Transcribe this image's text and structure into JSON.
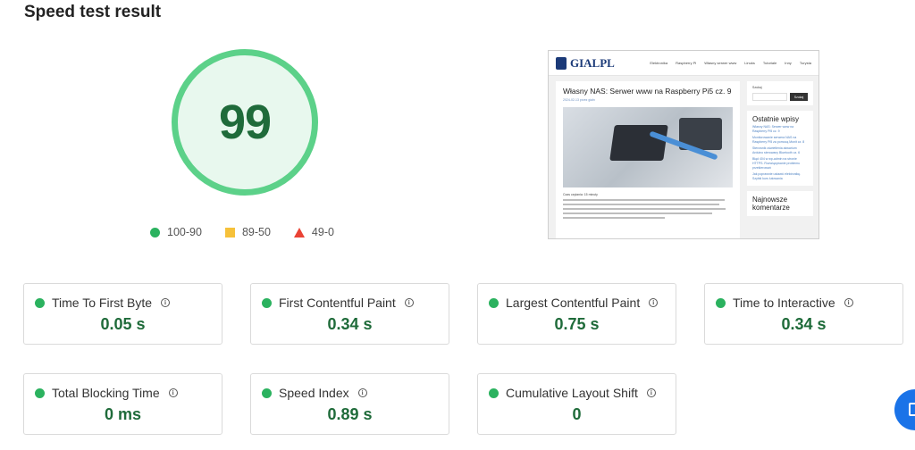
{
  "page": {
    "title": "Speed test result"
  },
  "score": {
    "value": "99",
    "color_good": "#5cd189",
    "legend": [
      {
        "label": "100-90",
        "shape": "circle",
        "color": "#2bb25f"
      },
      {
        "label": "89-50",
        "shape": "square",
        "color": "#f6c13a"
      },
      {
        "label": "49-0",
        "shape": "triangle",
        "color": "#ea4335"
      }
    ]
  },
  "preview": {
    "logo": "GIALPL",
    "menu": [
      "Elektronika",
      "Raspberry Pi",
      "Własny serwer www",
      "Linuks",
      "Tutoriale",
      "Inny",
      "Turysta"
    ],
    "post_title": "Własny NAS: Serwer www na Raspberry Pi5 cz. 9",
    "post_meta": "2024-02-13 przez gialn",
    "post_text": "Czas czytania: 15 minuty",
    "search_button": "Szukaj",
    "search_label": "Szukaj",
    "recent_title": "Ostatnie wpisy",
    "recent_links": [
      "Własny NAS: Serwer www na Raspberry Pi5 cz. 9",
      "Monitorowanie serwera NAS na Raspberry Pi5 za pomocą Monit cz. 8",
      "Sterownik oświetlenia akwarium Arduino sterowany Bluetooth cz. 6",
      "Błąd 404 w wp-admin na stronie HTTPS. Rozwiązywanie problemu przekierowań",
      "Jak poprawnie ustawić elektronikę. Szybki kurs lutowania"
    ],
    "comments_title": "Najnowsze komentarze"
  },
  "metrics": [
    {
      "label": "Time To First Byte",
      "value": "0.05 s"
    },
    {
      "label": "First Contentful Paint",
      "value": "0.34 s"
    },
    {
      "label": "Largest Contentful Paint",
      "value": "0.75 s"
    },
    {
      "label": "Time to Interactive",
      "value": "0.34 s"
    },
    {
      "label": "Total Blocking Time",
      "value": "0 ms"
    },
    {
      "label": "Speed Index",
      "value": "0.89 s"
    },
    {
      "label": "Cumulative Layout Shift",
      "value": "0"
    }
  ],
  "info_icon_glyph": "i",
  "status_color": "#2bb25f"
}
